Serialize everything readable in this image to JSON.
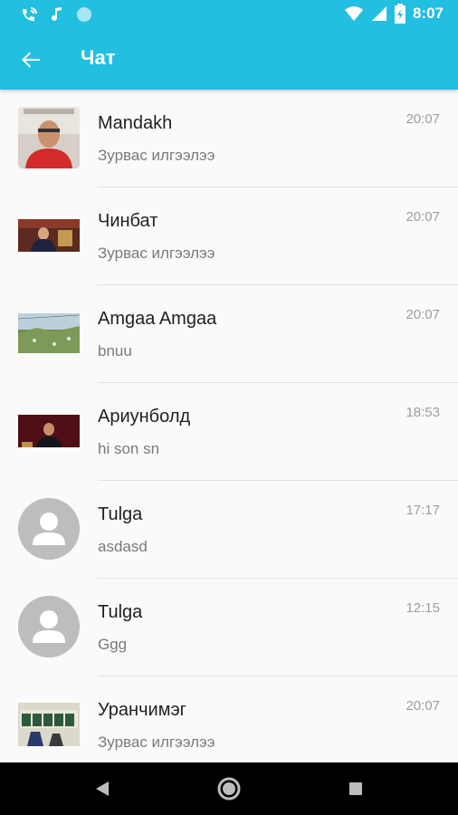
{
  "status_bar": {
    "time": "8:07",
    "left_icons": [
      "wifi-call-icon",
      "music-note-icon",
      "circle-icon"
    ],
    "right_icons": [
      "wifi-icon",
      "signal-icon",
      "battery-icon"
    ]
  },
  "app_bar": {
    "title": "Чат",
    "back_icon": "arrow-back-icon",
    "color": "#23bfe0"
  },
  "chats": [
    {
      "name": "Mandakh",
      "preview": "Зурвас илгээлээ",
      "time": "20:07",
      "avatar": "photo-portrait"
    },
    {
      "name": "Чинбат",
      "preview": "Зурвас илгээлээ",
      "time": "20:07",
      "avatar": "photo-meeting"
    },
    {
      "name": "Amgaa Amgaa",
      "preview": "bnuu",
      "time": "20:07",
      "avatar": "photo-landscape"
    },
    {
      "name": "Ариунболд",
      "preview": "hi son sn",
      "time": "18:53",
      "avatar": "photo-speaker"
    },
    {
      "name": "Tulga",
      "preview": "asdasd",
      "time": "17:17",
      "avatar": "default-person"
    },
    {
      "name": "Tulga",
      "preview": "Ggg",
      "time": "12:15",
      "avatar": "default-person"
    },
    {
      "name": "Уранчимэг",
      "preview": "Зурвас илгээлээ",
      "time": "20:07",
      "avatar": "photo-sign"
    }
  ],
  "nav_bar": {
    "buttons": [
      "back-triangle-icon",
      "home-circle-icon",
      "recents-square-icon"
    ]
  }
}
